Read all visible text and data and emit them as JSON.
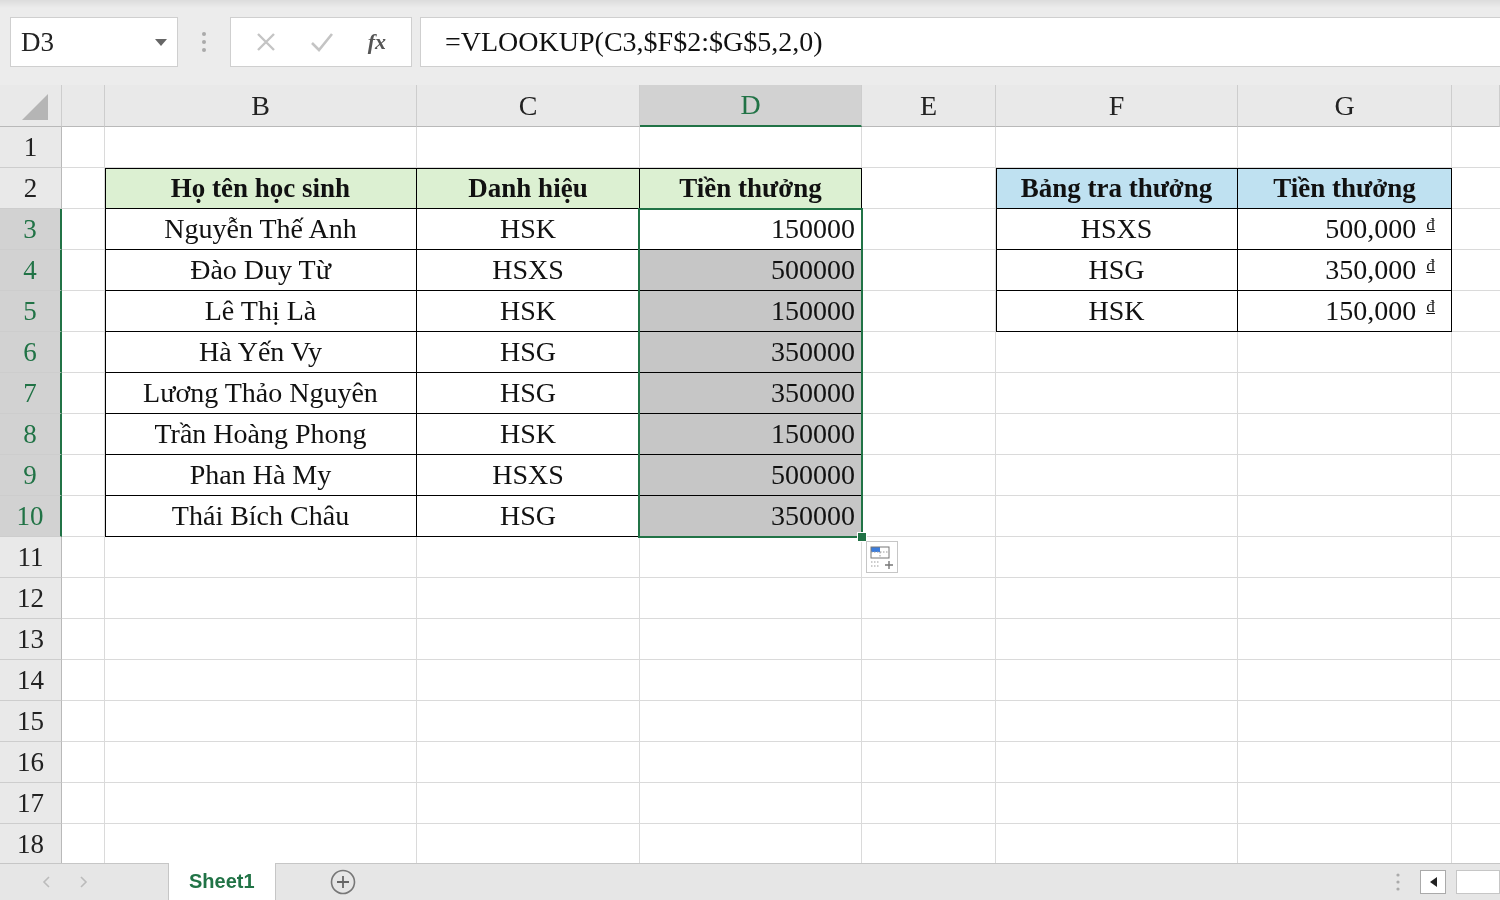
{
  "name_box": {
    "value": "D3"
  },
  "formula_bar": {
    "function_label": "fx",
    "formula": "=VLOOKUP(C3,$F$2:$G$5,2,0)"
  },
  "column_headers": [
    {
      "label": "B",
      "selected": false
    },
    {
      "label": "C",
      "selected": false
    },
    {
      "label": "D",
      "selected": true
    },
    {
      "label": "E",
      "selected": false
    },
    {
      "label": "F",
      "selected": false
    },
    {
      "label": "G",
      "selected": false
    }
  ],
  "row_headers": [
    {
      "label": "1",
      "selected": false
    },
    {
      "label": "2",
      "selected": false
    },
    {
      "label": "3",
      "selected": true
    },
    {
      "label": "4",
      "selected": true
    },
    {
      "label": "5",
      "selected": true
    },
    {
      "label": "6",
      "selected": true
    },
    {
      "label": "7",
      "selected": true
    },
    {
      "label": "8",
      "selected": true
    },
    {
      "label": "9",
      "selected": true
    },
    {
      "label": "10",
      "selected": true
    },
    {
      "label": "11",
      "selected": false
    },
    {
      "label": "12",
      "selected": false
    },
    {
      "label": "13",
      "selected": false
    },
    {
      "label": "14",
      "selected": false
    },
    {
      "label": "15",
      "selected": false
    },
    {
      "label": "16",
      "selected": false
    },
    {
      "label": "17",
      "selected": false
    },
    {
      "label": "18",
      "selected": false
    }
  ],
  "student_table": {
    "headers": [
      "Họ tên học sinh",
      "Danh hiệu",
      "Tiền thưởng"
    ],
    "rows": [
      {
        "name": "Nguyễn Thế Anh",
        "rank": "HSK",
        "reward": "150000",
        "selected": true,
        "active": true
      },
      {
        "name": "Đào Duy Từ",
        "rank": "HSXS",
        "reward": "500000",
        "selected": true,
        "active": false
      },
      {
        "name": "Lê Thị Là",
        "rank": "HSK",
        "reward": "150000",
        "selected": true,
        "active": false
      },
      {
        "name": "Hà Yến Vy",
        "rank": "HSG",
        "reward": "350000",
        "selected": true,
        "active": false
      },
      {
        "name": "Lương Thảo Nguyên",
        "rank": "HSG",
        "reward": "350000",
        "selected": true,
        "active": false
      },
      {
        "name": "Trần Hoàng Phong",
        "rank": "HSK",
        "reward": "150000",
        "selected": true,
        "active": false
      },
      {
        "name": "Phan Hà My",
        "rank": "HSXS",
        "reward": "500000",
        "selected": true,
        "active": false
      },
      {
        "name": "Thái Bích Châu",
        "rank": "HSG",
        "reward": "350000",
        "selected": true,
        "active": false
      }
    ]
  },
  "lookup_table": {
    "headers": [
      "Bảng tra thưởng",
      "Tiền thưởng"
    ],
    "rows": [
      {
        "rank": "HSXS",
        "reward": "500,000",
        "currency": "₫"
      },
      {
        "rank": "HSG",
        "reward": "350,000",
        "currency": "₫"
      },
      {
        "rank": "HSK",
        "reward": "150,000",
        "currency": "₫"
      }
    ]
  },
  "sheet_tabs": [
    {
      "label": "Sheet1",
      "selected": true
    }
  ]
}
